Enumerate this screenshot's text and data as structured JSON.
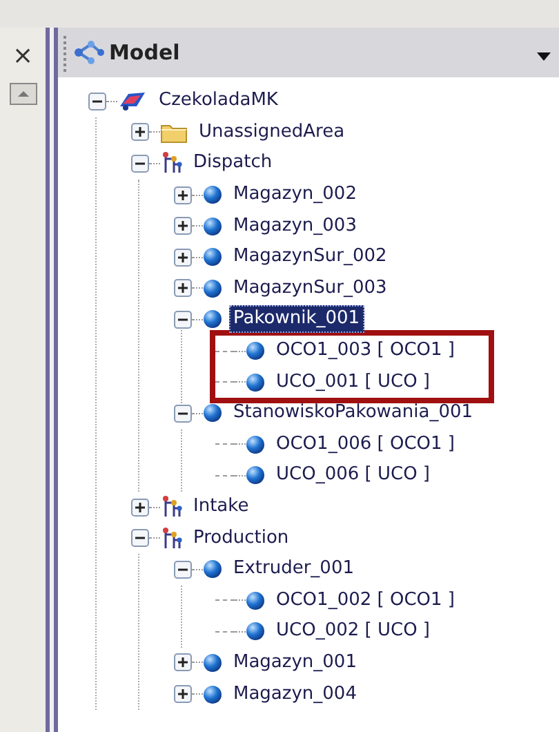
{
  "close_label": "×",
  "panel": {
    "title": "Model"
  },
  "tree": [
    {
      "label": "CzekoladaMK",
      "kind": "model",
      "expanded": true,
      "selected": false,
      "children": [
        {
          "label": "UnassignedArea",
          "kind": "folder",
          "expanded": false,
          "selected": false
        },
        {
          "label": "Dispatch",
          "kind": "area",
          "expanded": true,
          "selected": false,
          "children": [
            {
              "label": "Magazyn_002",
              "kind": "object",
              "expanded": false,
              "selected": false
            },
            {
              "label": "Magazyn_003",
              "kind": "object",
              "expanded": false,
              "selected": false
            },
            {
              "label": "MagazynSur_002",
              "kind": "object",
              "expanded": false,
              "selected": false
            },
            {
              "label": "MagazynSur_003",
              "kind": "object",
              "expanded": false,
              "selected": false
            },
            {
              "label": "Pakownik_001",
              "kind": "object",
              "expanded": true,
              "selected": true,
              "children_highlighted": true,
              "children": [
                {
                  "label": "OCO1_003 [ OCO1 ]",
                  "kind": "object",
                  "selected": false
                },
                {
                  "label": "UCO_001 [ UCO ]",
                  "kind": "object",
                  "selected": false
                }
              ]
            },
            {
              "label": "StanowiskoPakowania_001",
              "kind": "object",
              "expanded": true,
              "selected": false,
              "children_highlighted": false,
              "children": [
                {
                  "label": "OCO1_006 [ OCO1 ]",
                  "kind": "object",
                  "selected": false
                },
                {
                  "label": "UCO_006 [ UCO ]",
                  "kind": "object",
                  "selected": false
                }
              ]
            }
          ]
        },
        {
          "label": "Intake",
          "kind": "area",
          "expanded": false,
          "selected": false
        },
        {
          "label": "Production",
          "kind": "area",
          "expanded": true,
          "selected": false,
          "children": [
            {
              "label": "Extruder_001",
              "kind": "object",
              "expanded": true,
              "selected": false,
              "children_highlighted": false,
              "children": [
                {
                  "label": "OCO1_002 [ OCO1 ]",
                  "kind": "object",
                  "selected": false
                },
                {
                  "label": "UCO_002 [ UCO ]",
                  "kind": "object",
                  "selected": false
                }
              ]
            },
            {
              "label": "Magazyn_001",
              "kind": "object",
              "expanded": false,
              "selected": false
            },
            {
              "label": "Magazyn_004",
              "kind": "object",
              "expanded": false,
              "selected": false
            }
          ]
        }
      ]
    }
  ]
}
